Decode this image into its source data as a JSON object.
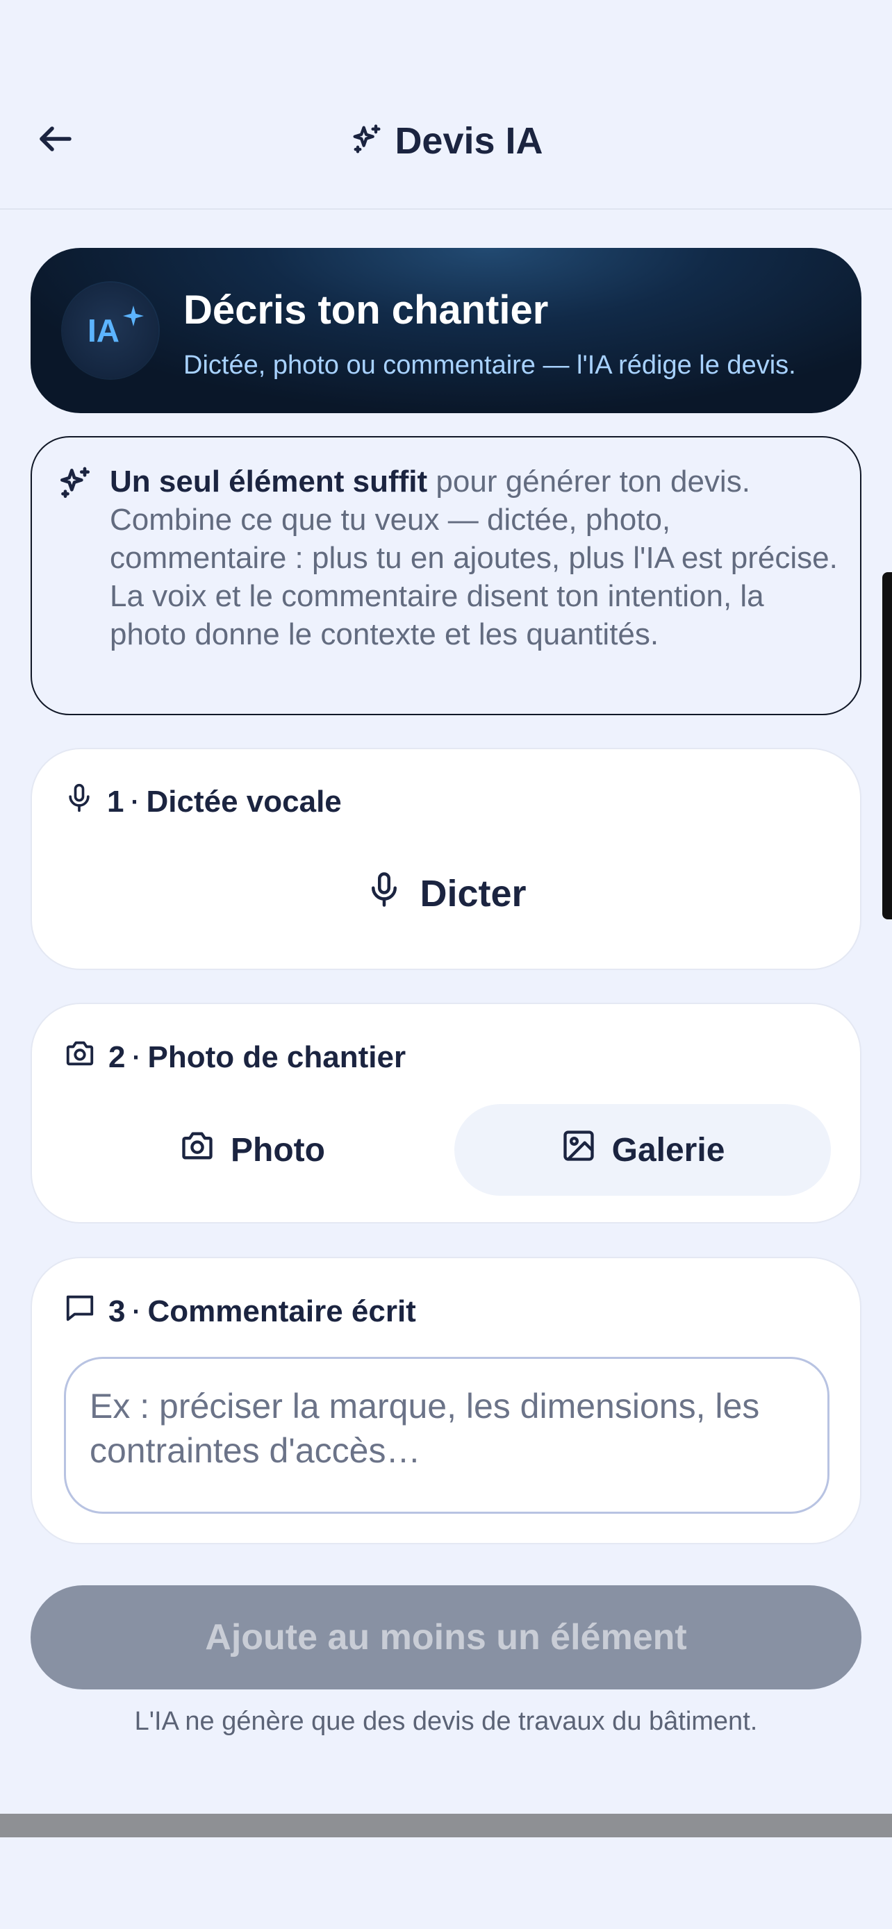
{
  "header": {
    "title": "Devis IA",
    "back_icon": "arrow-left-icon",
    "title_icon": "sparkles-icon"
  },
  "hero": {
    "badge": "IA",
    "title": "Décris ton chantier",
    "subtitle": "Dictée, photo ou commentaire — l'IA rédige le devis."
  },
  "info": {
    "bold": "Un seul élément suffit",
    "text": " pour générer ton devis. Combine ce que tu veux — dictée, photo, commentaire : plus tu en ajoutes, plus l'IA est précise. La voix et le commentaire disent ton intention, la photo donne le contexte et les quantités."
  },
  "sections": {
    "voice": {
      "number": "1",
      "label": "Dictée vocale",
      "button": "Dicter"
    },
    "photo": {
      "number": "2",
      "label": "Photo de chantier",
      "photo_button": "Photo",
      "gallery_button": "Galerie"
    },
    "comment": {
      "number": "3",
      "label": "Commentaire écrit",
      "placeholder": "Ex : préciser la marque, les dimensions, les contraintes d'accès…"
    }
  },
  "submit": {
    "label": "Ajoute au moins un élément"
  },
  "disclaimer": "L'IA ne génère que des devis de travaux du bâtiment.",
  "colors": {
    "background": "#eef2fd",
    "text": "#1b2440",
    "hero_dark": "#0a1729",
    "accent_blue": "#5cb4ff",
    "disabled_button": "#8891a3"
  }
}
